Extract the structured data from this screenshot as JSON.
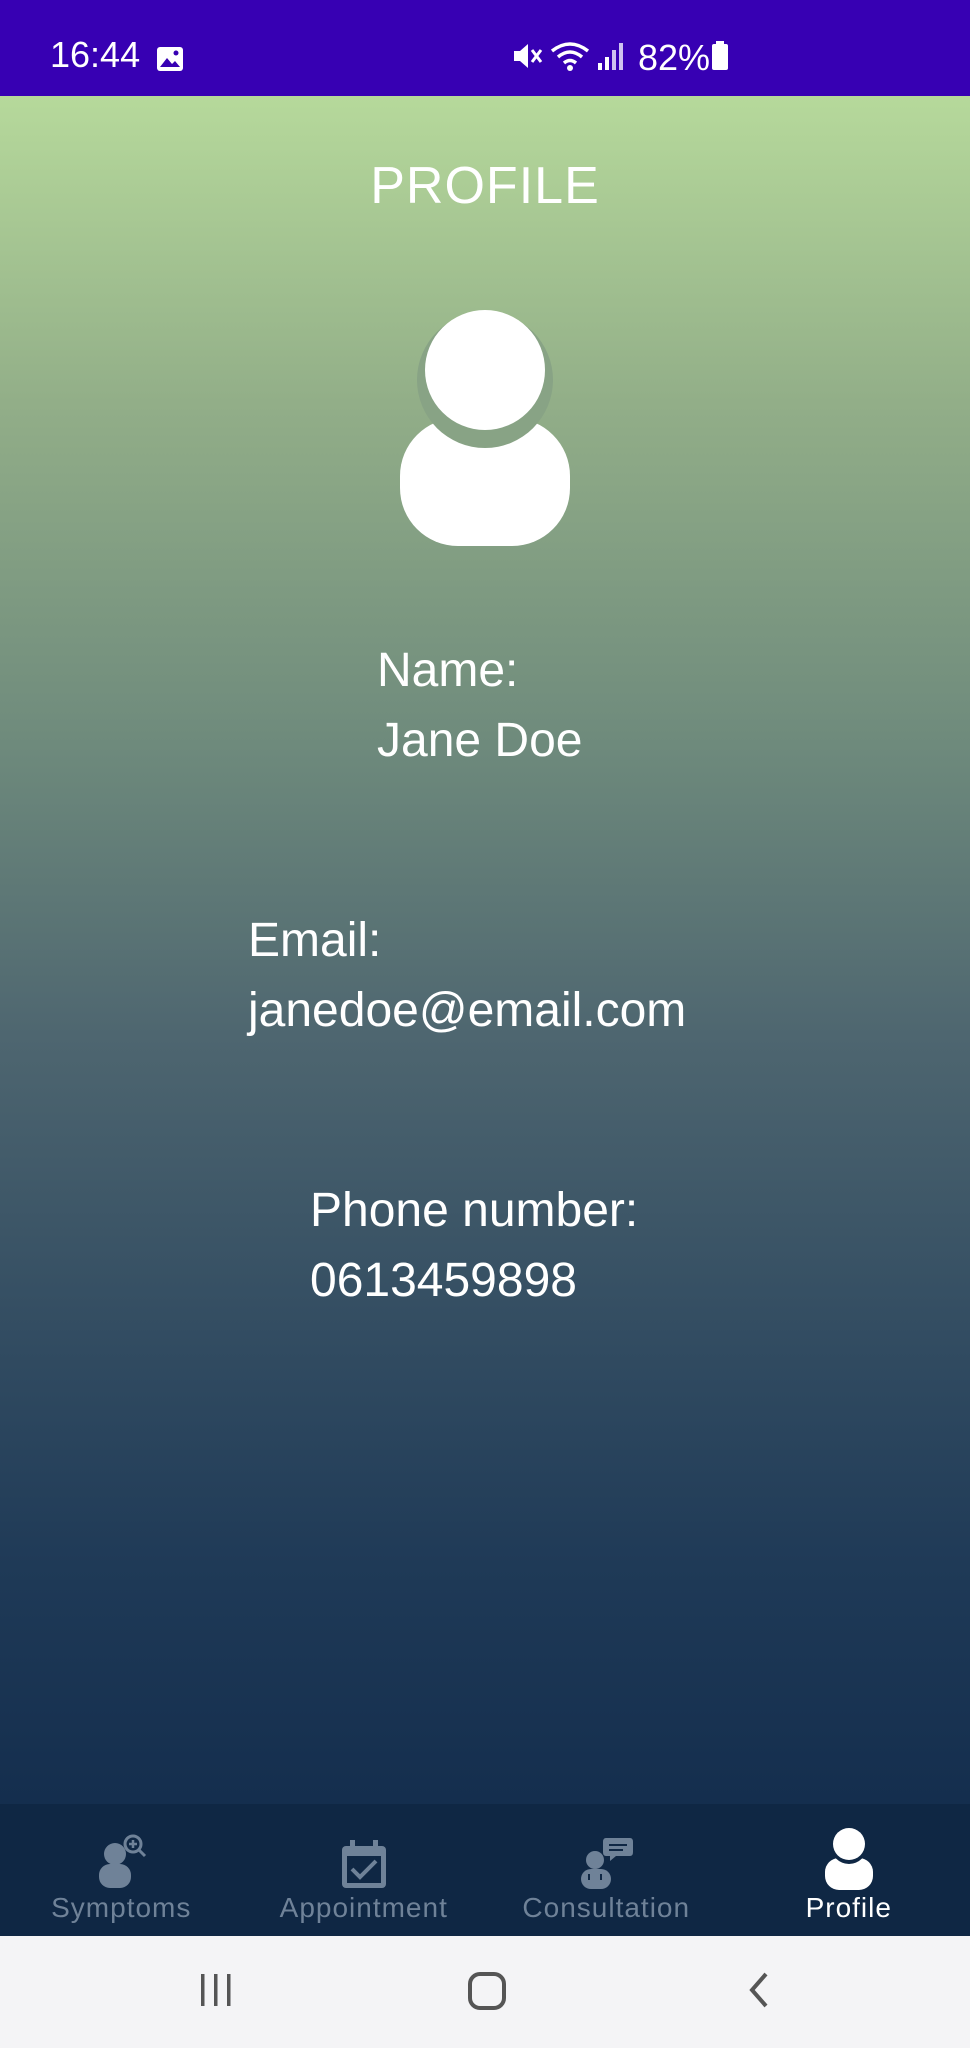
{
  "status_bar": {
    "time": "16:44",
    "battery": "82%",
    "icons": [
      "image-icon",
      "mute-icon",
      "wifi-icon",
      "signal-icon",
      "battery-icon"
    ]
  },
  "page": {
    "title": "PROFILE",
    "avatar_icon": "user-icon"
  },
  "profile": {
    "name_label": "Name:",
    "name_value": "Jane Doe",
    "email_label": "Email:",
    "email_value": "janedoe@email.com",
    "phone_label": "Phone number:",
    "phone_value": "0613459898"
  },
  "bottom_nav": {
    "items": [
      {
        "label": "Symptoms",
        "icon": "symptoms-icon",
        "active": false
      },
      {
        "label": "Appointment",
        "icon": "calendar-check-icon",
        "active": false
      },
      {
        "label": "Consultation",
        "icon": "consultation-icon",
        "active": false
      },
      {
        "label": "Profile",
        "icon": "user-icon",
        "active": true
      }
    ]
  },
  "system_nav": {
    "buttons": [
      "recent-apps",
      "home",
      "back"
    ]
  },
  "colors": {
    "status_bar": "#3700b3",
    "gradient_top": "#b6d99b",
    "gradient_bottom": "#142e4e",
    "nav_background": "#0f2744",
    "nav_inactive": "#6f8298",
    "nav_active": "#ffffff"
  }
}
